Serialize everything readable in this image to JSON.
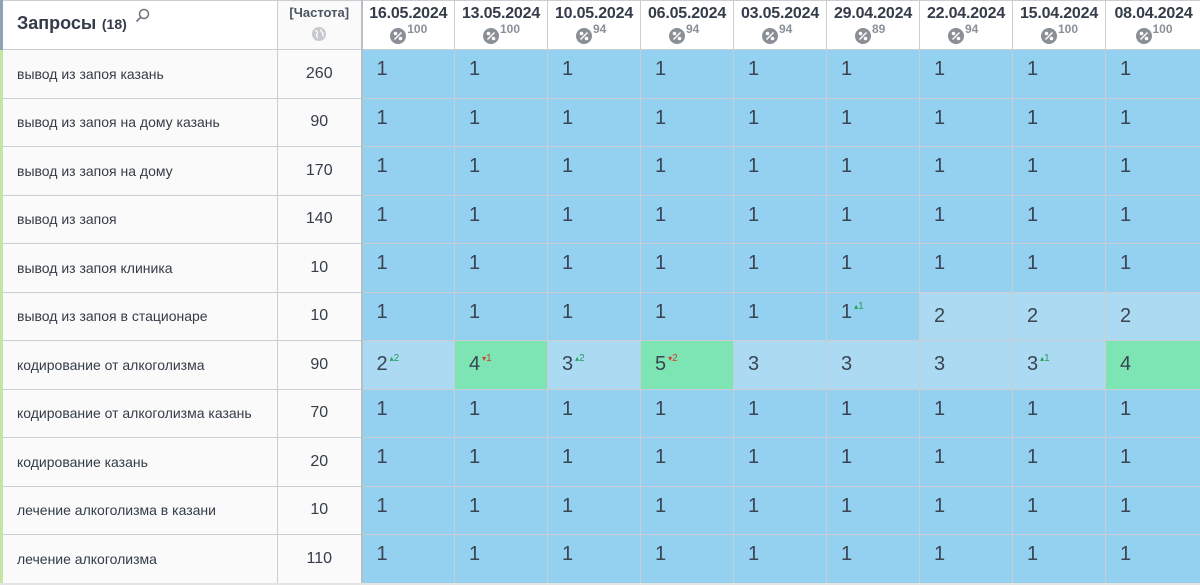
{
  "header": {
    "title": "Запросы",
    "count": "(18)",
    "freq_label": "[Частота]",
    "dates": [
      {
        "date": "16.05.2024",
        "pct": "100"
      },
      {
        "date": "13.05.2024",
        "pct": "100"
      },
      {
        "date": "10.05.2024",
        "pct": "94"
      },
      {
        "date": "06.05.2024",
        "pct": "94"
      },
      {
        "date": "03.05.2024",
        "pct": "94"
      },
      {
        "date": "29.04.2024",
        "pct": "89"
      },
      {
        "date": "22.04.2024",
        "pct": "94"
      },
      {
        "date": "15.04.2024",
        "pct": "100"
      },
      {
        "date": "08.04.2024",
        "pct": "100"
      }
    ]
  },
  "colors": {
    "top1": "#94d0ef",
    "top3": "#abdaf2",
    "top4": "#7de5b3",
    "delta_up": "#22a15a",
    "delta_down": "#d33a2c",
    "row_marker": "#c8e8a0"
  },
  "rows": [
    {
      "query": "вывод из запоя казань",
      "freq": "260",
      "cells": [
        {
          "v": "1"
        },
        {
          "v": "1"
        },
        {
          "v": "1"
        },
        {
          "v": "1"
        },
        {
          "v": "1"
        },
        {
          "v": "1"
        },
        {
          "v": "1"
        },
        {
          "v": "1"
        },
        {
          "v": "1"
        }
      ]
    },
    {
      "query": "вывод из запоя на дому казань",
      "freq": "90",
      "cells": [
        {
          "v": "1"
        },
        {
          "v": "1"
        },
        {
          "v": "1"
        },
        {
          "v": "1"
        },
        {
          "v": "1"
        },
        {
          "v": "1"
        },
        {
          "v": "1"
        },
        {
          "v": "1"
        },
        {
          "v": "1"
        }
      ]
    },
    {
      "query": "вывод из запоя на дому",
      "freq": "170",
      "cells": [
        {
          "v": "1"
        },
        {
          "v": "1"
        },
        {
          "v": "1"
        },
        {
          "v": "1"
        },
        {
          "v": "1"
        },
        {
          "v": "1"
        },
        {
          "v": "1"
        },
        {
          "v": "1"
        },
        {
          "v": "1"
        }
      ]
    },
    {
      "query": "вывод из запоя",
      "freq": "140",
      "cells": [
        {
          "v": "1"
        },
        {
          "v": "1"
        },
        {
          "v": "1"
        },
        {
          "v": "1"
        },
        {
          "v": "1"
        },
        {
          "v": "1"
        },
        {
          "v": "1"
        },
        {
          "v": "1"
        },
        {
          "v": "1"
        }
      ]
    },
    {
      "query": "вывод из запоя клиника",
      "freq": "10",
      "cells": [
        {
          "v": "1"
        },
        {
          "v": "1"
        },
        {
          "v": "1"
        },
        {
          "v": "1"
        },
        {
          "v": "1"
        },
        {
          "v": "1"
        },
        {
          "v": "1"
        },
        {
          "v": "1"
        },
        {
          "v": "1"
        }
      ]
    },
    {
      "query": "вывод из запоя в стационаре",
      "freq": "10",
      "cells": [
        {
          "v": "1"
        },
        {
          "v": "1"
        },
        {
          "v": "1"
        },
        {
          "v": "1"
        },
        {
          "v": "1"
        },
        {
          "v": "1",
          "d": "1",
          "dir": "up"
        },
        {
          "v": "2"
        },
        {
          "v": "2"
        },
        {
          "v": "2"
        }
      ]
    },
    {
      "query": "кодирование от алкоголизма",
      "freq": "90",
      "cells": [
        {
          "v": "2",
          "d": "2",
          "dir": "up"
        },
        {
          "v": "4",
          "d": "1",
          "dir": "down"
        },
        {
          "v": "3",
          "d": "2",
          "dir": "up"
        },
        {
          "v": "5",
          "d": "2",
          "dir": "down"
        },
        {
          "v": "3"
        },
        {
          "v": "3"
        },
        {
          "v": "3"
        },
        {
          "v": "3",
          "d": "1",
          "dir": "up"
        },
        {
          "v": "4"
        }
      ]
    },
    {
      "query": "кодирование от алкоголизма казань",
      "freq": "70",
      "cells": [
        {
          "v": "1"
        },
        {
          "v": "1"
        },
        {
          "v": "1"
        },
        {
          "v": "1"
        },
        {
          "v": "1"
        },
        {
          "v": "1"
        },
        {
          "v": "1"
        },
        {
          "v": "1"
        },
        {
          "v": "1"
        }
      ]
    },
    {
      "query": "кодирование казань",
      "freq": "20",
      "cells": [
        {
          "v": "1"
        },
        {
          "v": "1"
        },
        {
          "v": "1"
        },
        {
          "v": "1"
        },
        {
          "v": "1"
        },
        {
          "v": "1"
        },
        {
          "v": "1"
        },
        {
          "v": "1"
        },
        {
          "v": "1"
        }
      ]
    },
    {
      "query": "лечение алкоголизма в казани",
      "freq": "10",
      "cells": [
        {
          "v": "1"
        },
        {
          "v": "1"
        },
        {
          "v": "1"
        },
        {
          "v": "1"
        },
        {
          "v": "1"
        },
        {
          "v": "1"
        },
        {
          "v": "1"
        },
        {
          "v": "1"
        },
        {
          "v": "1"
        }
      ]
    },
    {
      "query": "лечение алкоголизма",
      "freq": "110",
      "cells": [
        {
          "v": "1"
        },
        {
          "v": "1"
        },
        {
          "v": "1"
        },
        {
          "v": "1"
        },
        {
          "v": "1"
        },
        {
          "v": "1"
        },
        {
          "v": "1"
        },
        {
          "v": "1"
        },
        {
          "v": "1"
        }
      ]
    }
  ]
}
